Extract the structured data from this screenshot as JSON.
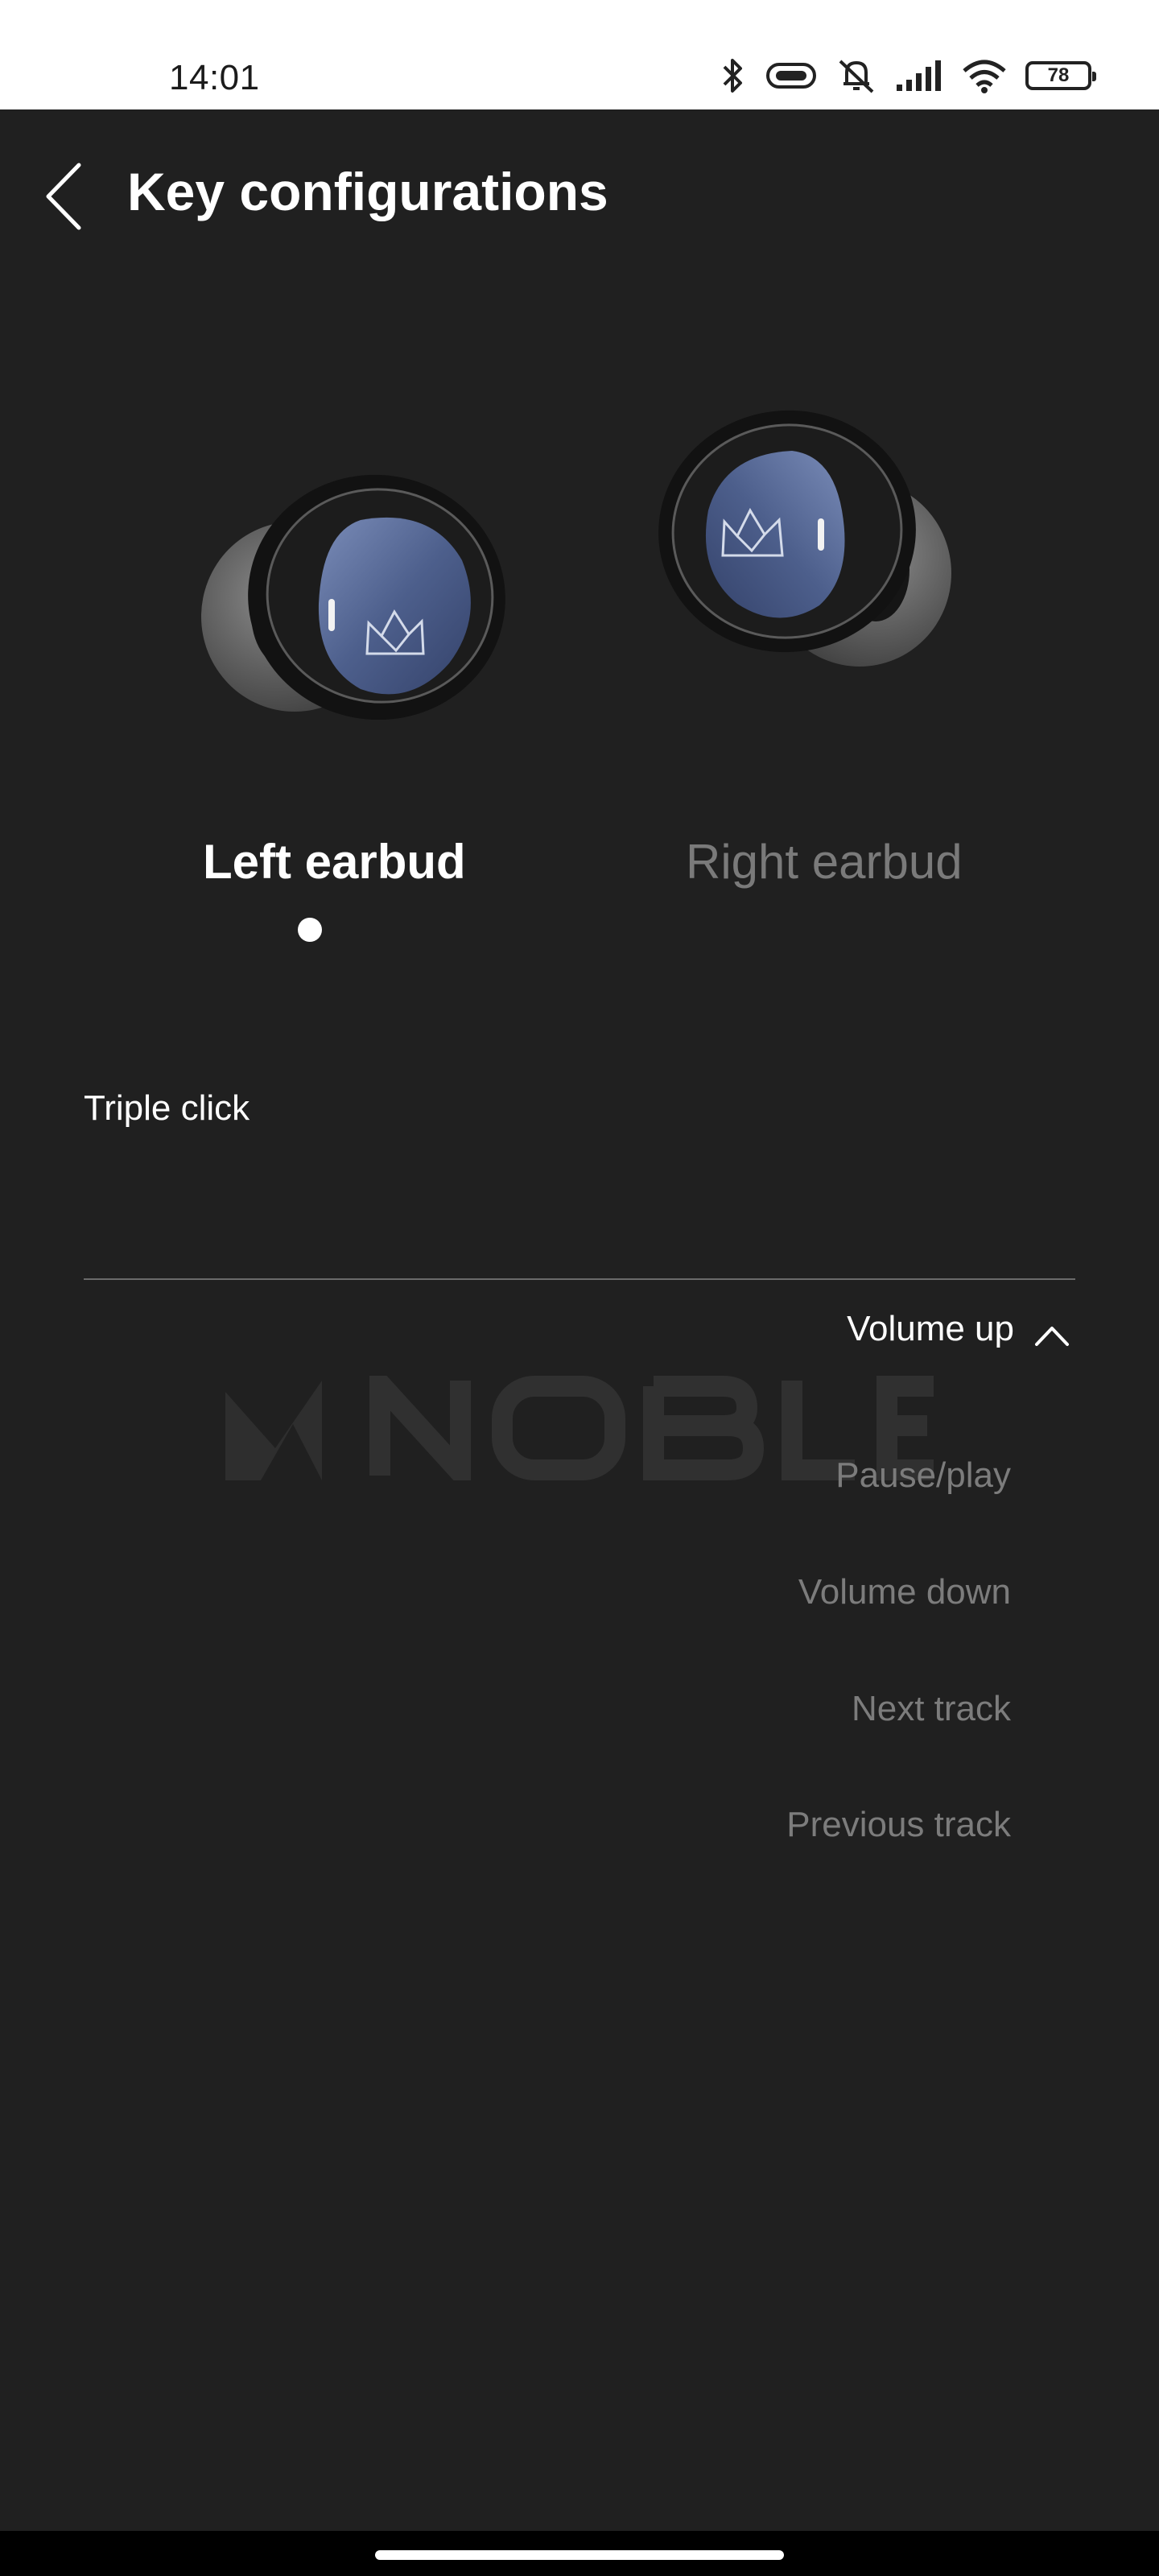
{
  "status_bar": {
    "time": "14:01",
    "battery": "78",
    "icons": [
      "bluetooth-icon",
      "vibrate-icon",
      "mute-icon",
      "signal-icon",
      "wifi-icon",
      "battery-icon"
    ]
  },
  "header": {
    "title": "Key configurations",
    "back_icon": "back-arrow-icon"
  },
  "earbuds": {
    "tabs": [
      {
        "label": "Left earbud",
        "selected": true
      },
      {
        "label": "Right earbud",
        "selected": false
      }
    ]
  },
  "setting": {
    "label": "Triple click",
    "selected": "Volume up",
    "options": [
      "Pause/play",
      "Volume down",
      "Next track",
      "Previous track"
    ]
  },
  "colors": {
    "background": "#202020",
    "primary_text": "#ffffff",
    "muted_text": "#7c7c7c",
    "earbud_face": "#5a6d97"
  }
}
